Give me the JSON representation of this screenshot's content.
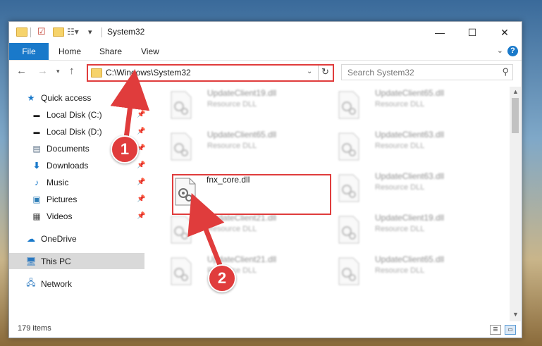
{
  "window": {
    "title": "System32",
    "controls": [
      "—",
      "☐",
      "✕"
    ]
  },
  "ribbon": {
    "tabs": [
      "File",
      "Home",
      "Share",
      "View"
    ],
    "help": "?"
  },
  "address": {
    "path": "C:\\Windows\\System32",
    "search_placeholder": "Search System32"
  },
  "sidebar": {
    "items": [
      {
        "label": "Quick access",
        "icon": "star-icon",
        "pinned": false
      },
      {
        "label": "Local Disk (C:)",
        "icon": "drive-icon",
        "pinned": true
      },
      {
        "label": "Local Disk (D:)",
        "icon": "drive-icon",
        "pinned": true
      },
      {
        "label": "Documents",
        "icon": "documents-icon",
        "pinned": true
      },
      {
        "label": "Downloads",
        "icon": "download-icon",
        "pinned": true
      },
      {
        "label": "Music",
        "icon": "music-icon",
        "pinned": true
      },
      {
        "label": "Pictures",
        "icon": "pictures-icon",
        "pinned": true
      },
      {
        "label": "Videos",
        "icon": "videos-icon",
        "pinned": true
      },
      {
        "label": "OneDrive",
        "icon": "cloud-icon",
        "pinned": false
      },
      {
        "label": "This PC",
        "icon": "computer-icon",
        "pinned": false,
        "selected": true
      },
      {
        "label": "Network",
        "icon": "network-icon",
        "pinned": false
      }
    ]
  },
  "files": [
    {
      "name": "UpdateClient19.dll",
      "type": "Resource DLL"
    },
    {
      "name": "UpdateClient65.dll",
      "type": "Resource DLL"
    },
    {
      "name": "UpdateClient65.dll",
      "type": "Resource DLL"
    },
    {
      "name": "UpdateClient63.dll",
      "type": "Resource DLL"
    },
    {
      "name": "fnx_core.dll",
      "type": ""
    },
    {
      "name": "UpdateClient63.dll",
      "type": "Resource DLL"
    },
    {
      "name": "UpdateClient21.dll",
      "type": "Resource DLL"
    },
    {
      "name": "UpdateClient19.dll",
      "type": "Resource DLL"
    },
    {
      "name": "UpdateClient21.dll",
      "type": "Resource DLL"
    },
    {
      "name": "UpdateClient65.dll",
      "type": "Resource DLL"
    }
  ],
  "status": {
    "item_count": "179 items"
  },
  "callouts": [
    "1",
    "2"
  ],
  "colors": {
    "accent": "#1979ca",
    "highlight": "#e03c3c",
    "selected_bg": "#d9d9d9"
  }
}
